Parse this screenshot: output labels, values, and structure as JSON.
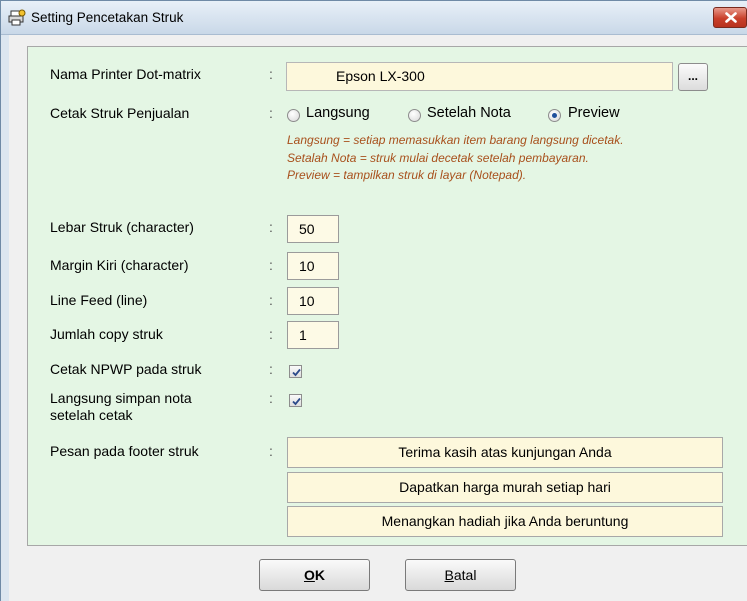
{
  "window": {
    "title": "Setting Pencetakan Struk",
    "title_icon": "printer-settings-icon",
    "close_icon": "close-icon"
  },
  "form": {
    "printer": {
      "label": "Nama Printer Dot-matrix",
      "value": "Epson LX-300",
      "browse_label": "..."
    },
    "print_mode": {
      "label": "Cetak Struk Penjualan",
      "options": [
        {
          "label": "Langsung",
          "checked": false
        },
        {
          "label": "Setelah Nota",
          "checked": false
        },
        {
          "label": "Preview",
          "checked": true
        }
      ],
      "hints": [
        "Langsung = setiap memasukkan item barang langsung dicetak.",
        "Setalah Nota = struk mulai decetak setelah pembayaran.",
        "Preview = tampilkan struk di layar (Notepad)."
      ]
    },
    "receipt_width": {
      "label": "Lebar Struk (character)",
      "value": "50"
    },
    "left_margin": {
      "label": "Margin Kiri (character)",
      "value": "10"
    },
    "line_feed": {
      "label": "Line Feed (line)",
      "value": "10"
    },
    "copies": {
      "label": "Jumlah copy struk",
      "value": "1"
    },
    "print_npwp": {
      "label": "Cetak NPWP pada struk",
      "checked": true
    },
    "save_after_print": {
      "label_line1": "Langsung simpan nota",
      "label_line2": "setelah cetak",
      "checked": true
    },
    "footer": {
      "label": "Pesan pada footer struk",
      "lines": [
        "Terima kasih atas kunjungan Anda",
        "Dapatkan harga murah setiap hari",
        "Menangkan hadiah jika Anda beruntung"
      ]
    },
    "colon": ":"
  },
  "buttons": {
    "ok_mnemonic": "O",
    "ok_rest": "K",
    "cancel_mnemonic": "B",
    "cancel_rest": "atal"
  },
  "colors": {
    "panel_background": "#e4f6e4",
    "input_background": "#fdf8dc",
    "hint_text": "#a8501c",
    "close_button": "#c9402b"
  }
}
